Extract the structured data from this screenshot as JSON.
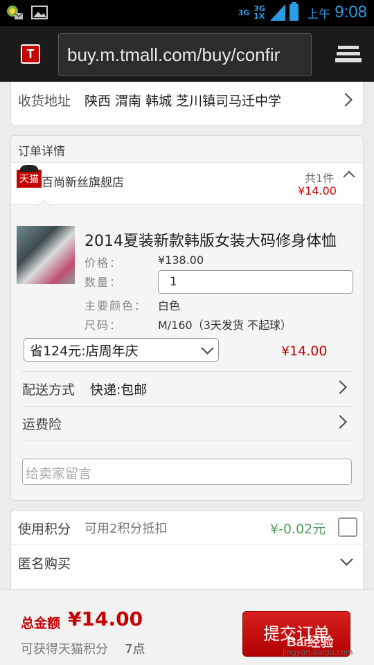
{
  "status_bar": {
    "network_1": "3G",
    "network_2": "3G 1X",
    "ampm": "上午",
    "time": "9:08"
  },
  "browser": {
    "app_logo": "T",
    "url": "buy.m.tmall.com/buy/confir"
  },
  "address": {
    "label": "收货地址",
    "value": "陕西 渭南 韩城 芝川镇司马迁中学"
  },
  "order": {
    "header": "订单详情",
    "store": {
      "badge": "天猫",
      "name": "百尚新丝旗舰店",
      "count": "共1件",
      "price": "¥14.00"
    },
    "product": {
      "title": "2014夏装新款韩版女装大码修身体恤",
      "price_label": "价格：",
      "price_value": "¥138.00",
      "qty_label": "数量：",
      "qty_value": "1",
      "color_label": "主要颜色：",
      "color_value": "白色",
      "size_label": "尺码：",
      "size_value": "M/160（3天发货 不起球）"
    },
    "promo": {
      "selected": "省124元:店周年庆",
      "price": "¥14.00"
    },
    "shipping": {
      "label": "配送方式",
      "value": "快递:包邮"
    },
    "insurance": {
      "label": "运费险"
    },
    "message": {
      "placeholder": "给卖家留言"
    }
  },
  "points": {
    "label": "使用积分",
    "desc": "可用2积分抵扣",
    "amount": "¥-0.02元"
  },
  "anonymous": {
    "label": "匿名购买"
  },
  "footer": {
    "total_label": "总金额",
    "total_value": "¥14.00",
    "earn_label": "可获得天猫积分",
    "earn_value": "7点",
    "submit_label": "提交订单"
  },
  "watermark": {
    "text": "Bai经验",
    "sub": "jingyan.baidu.com"
  }
}
